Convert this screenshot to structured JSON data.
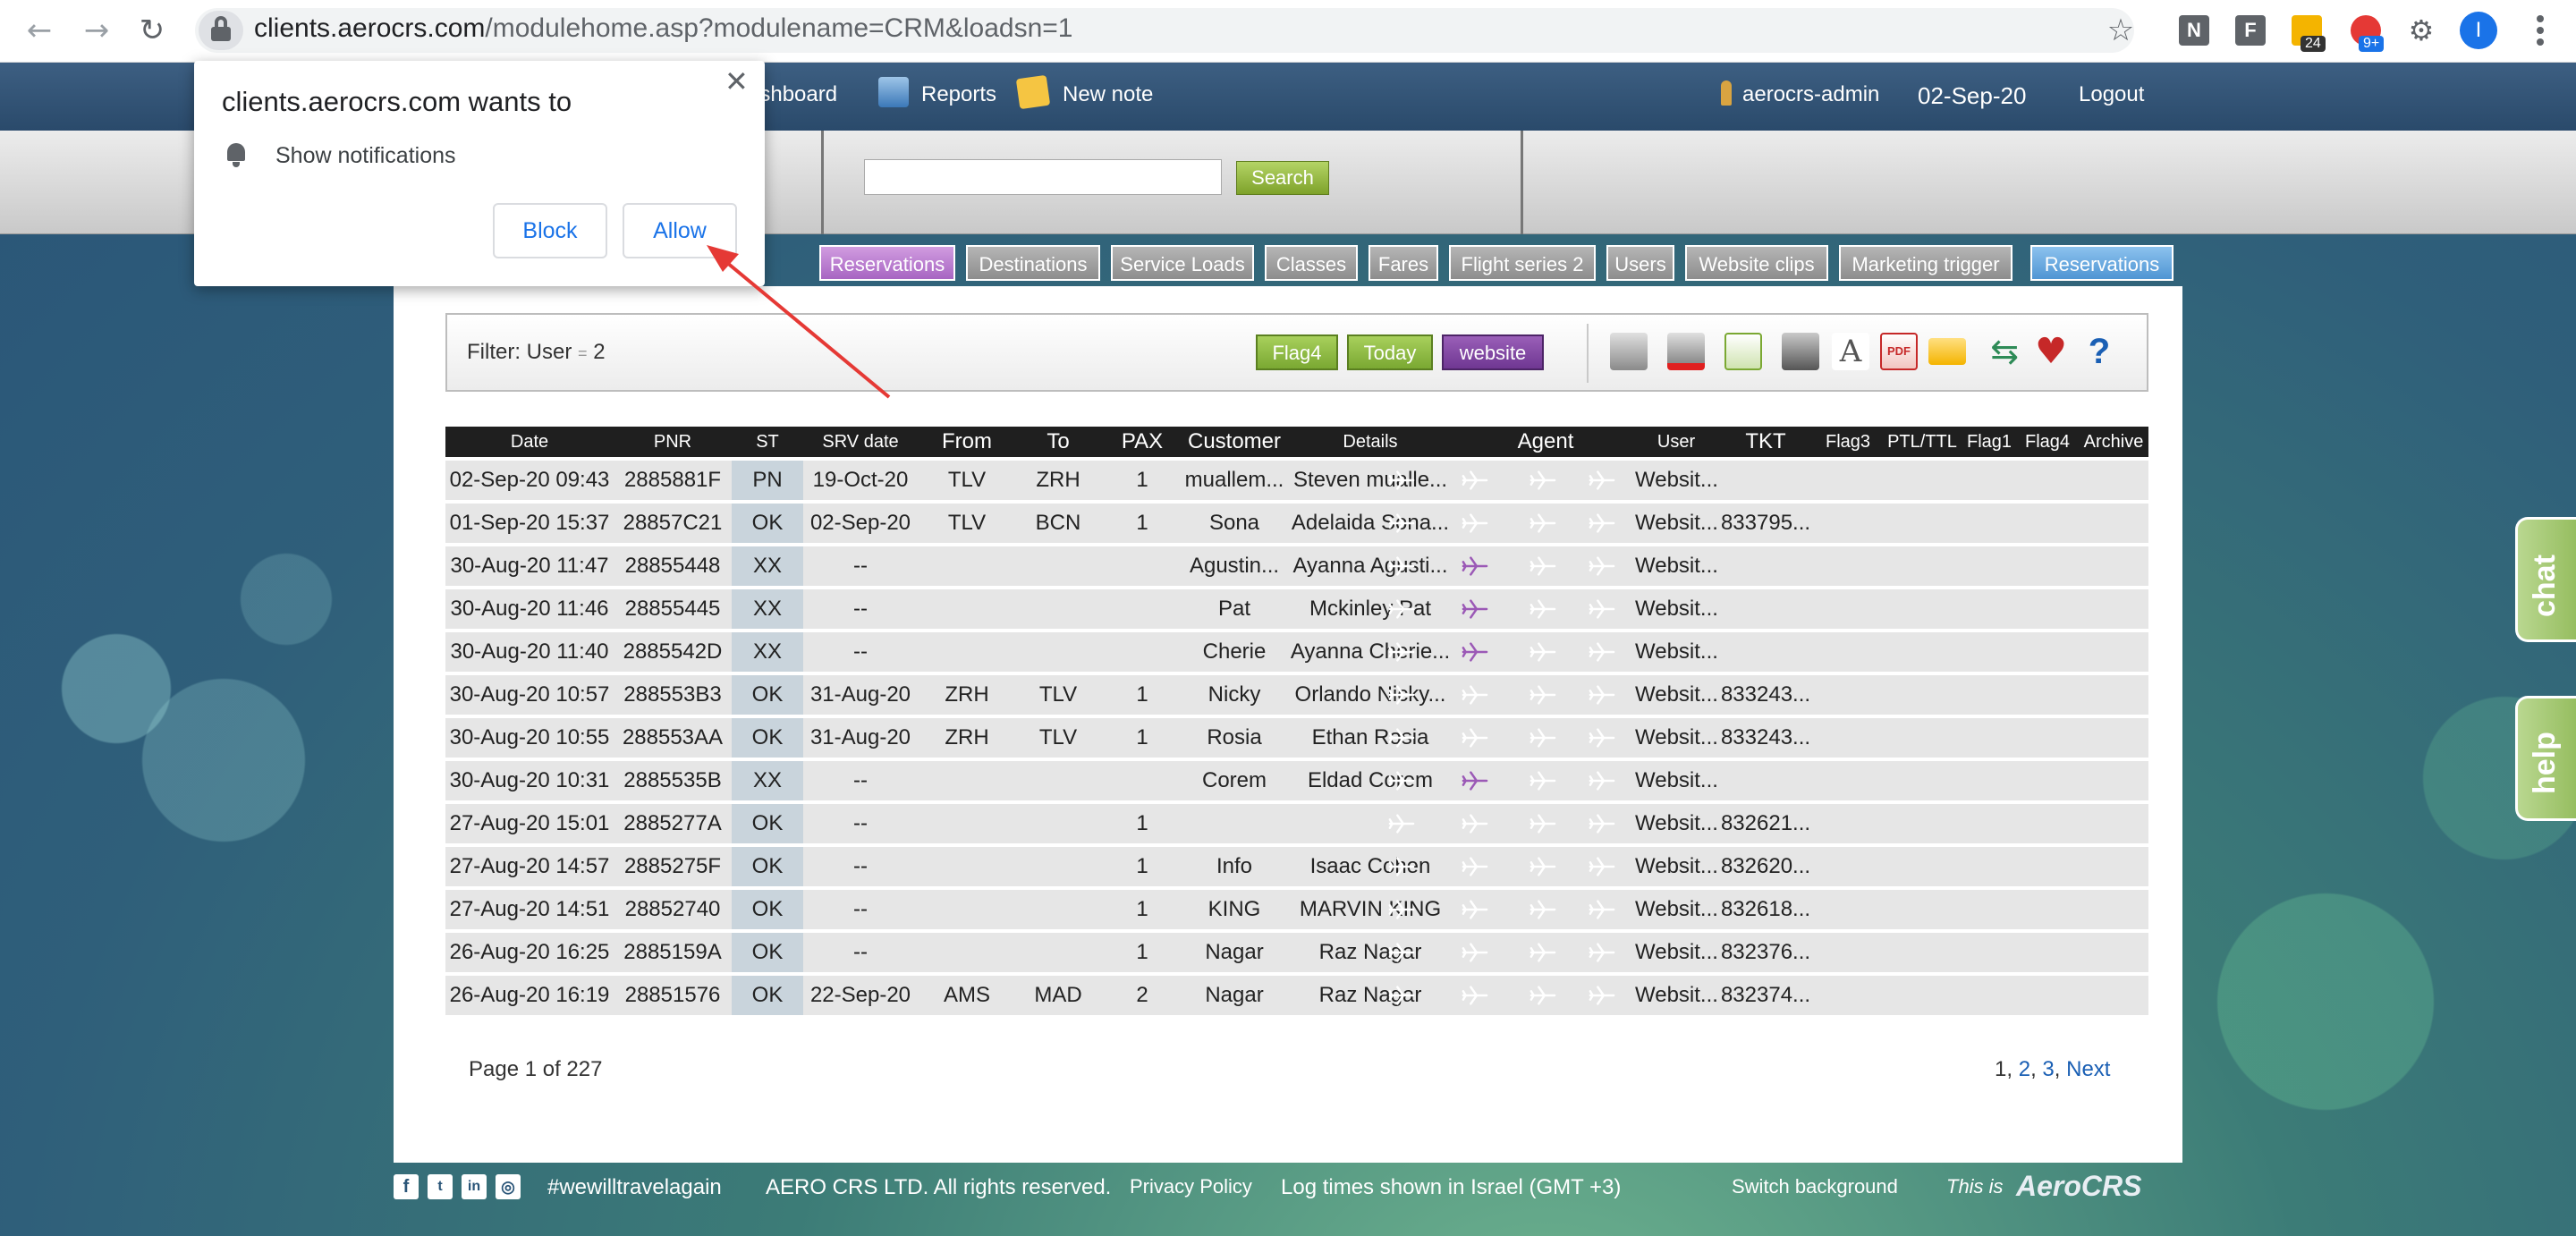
{
  "browser": {
    "url_host": "clients.aerocrs.com",
    "url_path": "/modulehome.asp?modulename=CRM&loadsn=1",
    "ext_badges": {
      "calendar": "24",
      "rss": "9+"
    },
    "ext_labels": {
      "n": "N",
      "f": "F"
    },
    "profile_initial": "I"
  },
  "header": {
    "nav": {
      "dashboard": "ashboard",
      "reports": "Reports",
      "new_note": "New note"
    },
    "user": "aerocrs-admin",
    "date": "02-Sep-20",
    "logout": "Logout"
  },
  "search": {
    "value": "",
    "button": "Search"
  },
  "tabs": [
    {
      "label": "Reservations",
      "state": "active"
    },
    {
      "label": "Destinations"
    },
    {
      "label": "Service Loads"
    },
    {
      "label": "Classes"
    },
    {
      "label": "Fares"
    },
    {
      "label": "Flight series 2"
    },
    {
      "label": "Users"
    },
    {
      "label": "Website clips"
    },
    {
      "label": "Marketing trigger"
    },
    {
      "label": "Reservations",
      "state": "blue"
    }
  ],
  "filter": {
    "label": "Filter: User",
    "operator": "=",
    "value": "2",
    "buttons": [
      "Flag4",
      "Today",
      "website"
    ]
  },
  "toolbar_icons": [
    "database-icon",
    "delete-icon",
    "export-icon",
    "print-icon",
    "font-icon",
    "pdf-icon",
    "email-icon",
    "refresh-icon",
    "heart-icon",
    "help-icon"
  ],
  "table": {
    "columns": [
      "Date",
      "PNR",
      "ST",
      "SRV date",
      "From",
      "To",
      "PAX",
      "Customer",
      "Details",
      "Agent",
      "User",
      "TKT",
      "Flag3",
      "PTL/TTL",
      "Flag1",
      "Flag4",
      "Archive"
    ],
    "rows": [
      {
        "date": "02-Sep-20 09:43",
        "pnr": "2885881F",
        "st": "PN",
        "srv": "19-Oct-20",
        "from": "TLV",
        "to": "ZRH",
        "pax": "1",
        "customer": "muallem...",
        "details": "Steven mualle...",
        "agent": "",
        "user": "Websit...",
        "tkt": "",
        "ptl_active": false
      },
      {
        "date": "01-Sep-20 15:37",
        "pnr": "28857C21",
        "st": "OK",
        "srv": "02-Sep-20",
        "from": "TLV",
        "to": "BCN",
        "pax": "1",
        "customer": "Sona",
        "details": "Adelaida Sona...",
        "agent": "",
        "user": "Websit...",
        "tkt": "833795...",
        "ptl_active": false
      },
      {
        "date": "30-Aug-20 11:47",
        "pnr": "28855448",
        "st": "XX",
        "srv": "--",
        "from": "",
        "to": "",
        "pax": "",
        "customer": "Agustin...",
        "details": "Ayanna Agusti...",
        "agent": "",
        "user": "Websit...",
        "tkt": "",
        "ptl_active": true
      },
      {
        "date": "30-Aug-20 11:46",
        "pnr": "28855445",
        "st": "XX",
        "srv": "--",
        "from": "",
        "to": "",
        "pax": "",
        "customer": "Pat",
        "details": "Mckinley Pat",
        "agent": "",
        "user": "Websit...",
        "tkt": "",
        "ptl_active": true
      },
      {
        "date": "30-Aug-20 11:40",
        "pnr": "2885542D",
        "st": "XX",
        "srv": "--",
        "from": "",
        "to": "",
        "pax": "",
        "customer": "Cherie",
        "details": "Ayanna Cherie...",
        "agent": "",
        "user": "Websit...",
        "tkt": "",
        "ptl_active": true
      },
      {
        "date": "30-Aug-20 10:57",
        "pnr": "288553B3",
        "st": "OK",
        "srv": "31-Aug-20",
        "from": "ZRH",
        "to": "TLV",
        "pax": "1",
        "customer": "Nicky",
        "details": "Orlando Nicky...",
        "agent": "",
        "user": "Websit...",
        "tkt": "833243...",
        "ptl_active": false
      },
      {
        "date": "30-Aug-20 10:55",
        "pnr": "288553AA",
        "st": "OK",
        "srv": "31-Aug-20",
        "from": "ZRH",
        "to": "TLV",
        "pax": "1",
        "customer": "Rosia",
        "details": "Ethan Rosia",
        "agent": "",
        "user": "Websit...",
        "tkt": "833243...",
        "ptl_active": false
      },
      {
        "date": "30-Aug-20 10:31",
        "pnr": "2885535B",
        "st": "XX",
        "srv": "--",
        "from": "",
        "to": "",
        "pax": "",
        "customer": "Corem",
        "details": "Eldad Corem",
        "agent": "",
        "user": "Websit...",
        "tkt": "",
        "ptl_active": true
      },
      {
        "date": "27-Aug-20 15:01",
        "pnr": "2885277A",
        "st": "OK",
        "srv": "--",
        "from": "",
        "to": "",
        "pax": "1",
        "customer": "",
        "details": "",
        "agent": "",
        "user": "Websit...",
        "tkt": "832621...",
        "ptl_active": false
      },
      {
        "date": "27-Aug-20 14:57",
        "pnr": "2885275F",
        "st": "OK",
        "srv": "--",
        "from": "",
        "to": "",
        "pax": "1",
        "customer": "Info",
        "details": "Isaac Cohen",
        "agent": "",
        "user": "Websit...",
        "tkt": "832620...",
        "ptl_active": false
      },
      {
        "date": "27-Aug-20 14:51",
        "pnr": "28852740",
        "st": "OK",
        "srv": "--",
        "from": "",
        "to": "",
        "pax": "1",
        "customer": "KING",
        "details": "MARVIN KING",
        "agent": "",
        "user": "Websit...",
        "tkt": "832618...",
        "ptl_active": false
      },
      {
        "date": "26-Aug-20 16:25",
        "pnr": "2885159A",
        "st": "OK",
        "srv": "--",
        "from": "",
        "to": "",
        "pax": "1",
        "customer": "Nagar",
        "details": "Raz Nagar",
        "agent": "",
        "user": "Websit...",
        "tkt": "832376...",
        "ptl_active": false
      },
      {
        "date": "26-Aug-20 16:19",
        "pnr": "28851576",
        "st": "OK",
        "srv": "22-Sep-20",
        "from": "AMS",
        "to": "MAD",
        "pax": "2",
        "customer": "Nagar",
        "details": "Raz Nagar",
        "agent": "",
        "user": "Websit...",
        "tkt": "832374...",
        "ptl_active": false
      }
    ]
  },
  "pagination": {
    "info": "Page 1 of 227",
    "current": "1",
    "pages": [
      "2",
      "3"
    ],
    "next": "Next"
  },
  "side_tabs": {
    "chat": "chat",
    "help": "help"
  },
  "footer": {
    "social_labels": {
      "facebook": "f",
      "twitter": "t",
      "linkedin": "in",
      "instagram": "◎"
    },
    "hashtag": "#wewilltravelagain",
    "copyright": "AERO CRS LTD. All rights reserved.",
    "privacy": "Privacy Policy",
    "log_times": "Log times shown in Israel (GMT +3)",
    "switch_bg": "Switch background",
    "this_is": "This is",
    "brand": "AeroCRS"
  },
  "popup": {
    "title": "clients.aerocrs.com wants to",
    "permission": "Show notifications",
    "block": "Block",
    "allow": "Allow"
  },
  "colors": {
    "plane_inactive": "#ffffff",
    "plane_active": "#9b59b6",
    "annotation_arrow": "#e53935"
  }
}
